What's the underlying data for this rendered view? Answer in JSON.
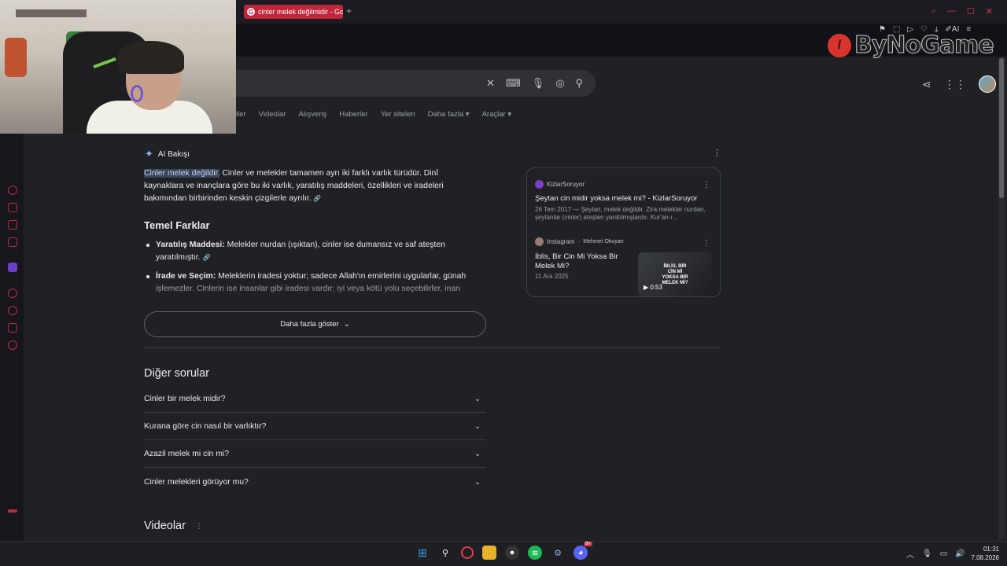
{
  "browser": {
    "tab_title": "cinler melek değilmidir - Go",
    "new_tab": "+",
    "ai_toolbar_label": "AI"
  },
  "watermark": {
    "text": "ByNoGame"
  },
  "search": {
    "nav_tabs": [
      "ller",
      "Videolar",
      "Alışveriş",
      "Haberler",
      "Yer sitelen",
      "Daha fazla",
      "Araçlar"
    ]
  },
  "ai_overview": {
    "label": "AI Bakışı",
    "highlight": "Cinler melek değildir.",
    "para_rest": " Cinler ve melekler tamamen ayrı iki farklı varlık türüdür. Dinî kaynaklara ve inançlara göre bu iki varlık, yaratılış maddeleri, özellikleri ve iradeleri bakımından birbirinden keskin çizgilerle ayrılır.",
    "heading": "Temel Farklar",
    "bullets": [
      {
        "title": "Yaratılış Maddesi:",
        "text": " Melekler nurdan (ışıktan), cinler ise dumansız ve saf ateşten yaratılmıştır."
      },
      {
        "title": "İrade ve Seçim:",
        "text": " Meleklerin iradesi yoktur; sadece Allah'ın emirlerini uygularlar, günah işlemezler. Cinlerin ise insanlar gibi iradesi vardır; iyi veya kötü yolu seçebilirler, inan"
      }
    ],
    "more_button": "Daha fazla göster"
  },
  "sources": [
    {
      "site": "KizlarSoruyor",
      "title": "Şeytan cin midir yoksa melek mi? - KizlarSoruyor",
      "meta": "26 Tem 2017 — Şeytan, melek değildir. Zira melekler nurdan, şeytanlar (cinler) ateşten yaratılmışlardır. Kur'an-ı…"
    },
    {
      "site": "Instagram",
      "author": "Mehmet Okuyan",
      "title": "İblis, Bir Cin Mi Yoksa Bir Melek Mi?",
      "meta": "11 Ara 2025",
      "thumb_text": "İBLİS, BİR CİN Mİ YOKSA BİR MELEK Mİ?",
      "duration": "0:53"
    }
  ],
  "other_questions": {
    "heading": "Diğer sorular",
    "items": [
      "Cinler bir melek midir?",
      "Kurana göre cin nasıl bir varlıktır?",
      "Azazil melek mi cin mi?",
      "Cinler melekleri görüyor mu?"
    ]
  },
  "videos": {
    "heading": "Videolar"
  },
  "taskbar": {
    "time": "01:31",
    "date": "7.08.2026",
    "discord_badge": "9+"
  },
  "colors": {
    "background": "#202124",
    "accent_red": "#c0263a",
    "link_blue": "#8ab4f8"
  }
}
